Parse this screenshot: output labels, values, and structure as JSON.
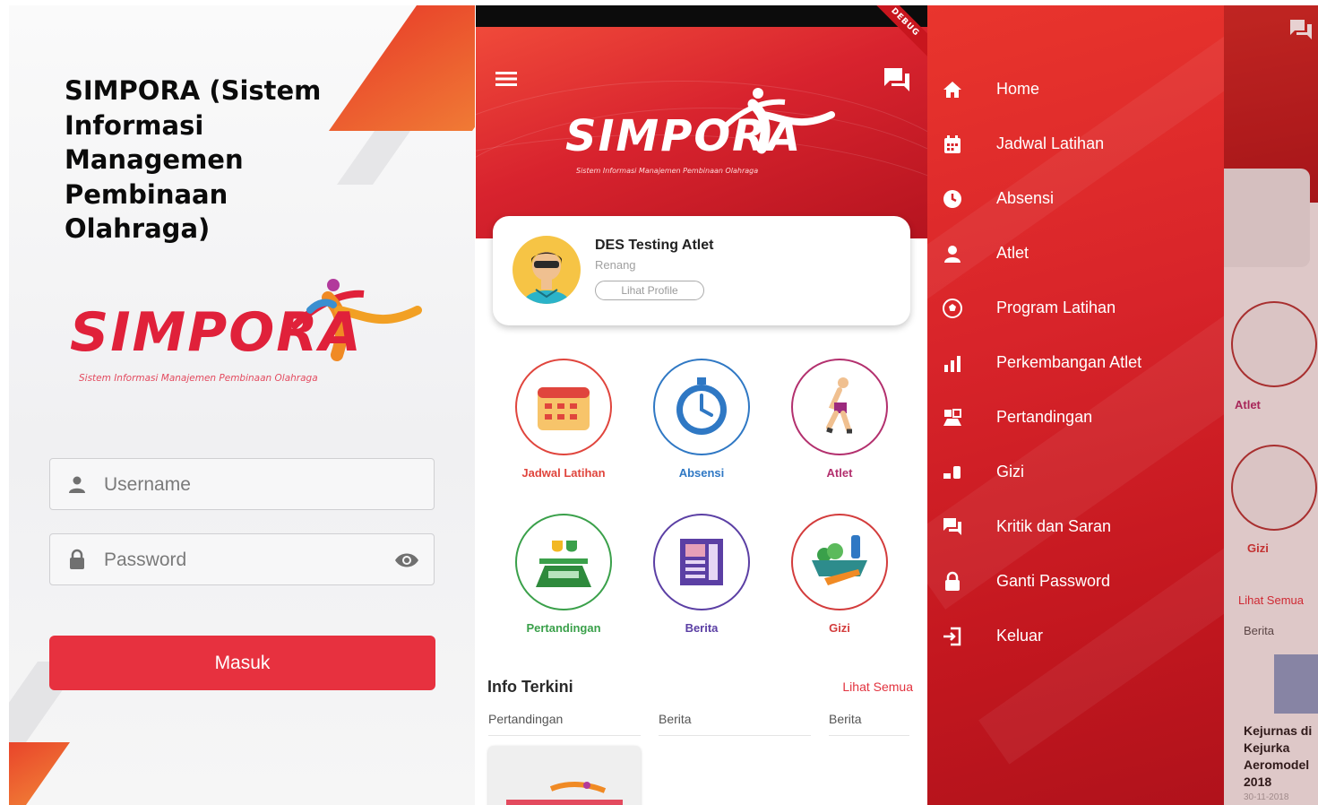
{
  "login": {
    "app_title": "SIMPORA (Sistem Informasi Managemen Pembinaan Olahraga)",
    "logo_word": "SIMPORA",
    "logo_tagline": "Sistem Informasi Manajemen Pembinaan Olahraga",
    "username_placeholder": "Username",
    "password_placeholder": "Password",
    "login_button": "Masuk"
  },
  "home": {
    "debug_banner": "DEBUG",
    "logo_word": "SIMPORA",
    "logo_tagline": "Sistem Informasi Manajemen Pembinaan Olahraga",
    "profile": {
      "name": "DES Testing Atlet",
      "sport": "Renang",
      "view_profile": "Lihat Profile"
    },
    "features": [
      {
        "label": "Jadwal Latihan",
        "color": "#e0453d",
        "icon": "calendar-icon"
      },
      {
        "label": "Absensi",
        "color": "#2f78c4",
        "icon": "stopwatch-icon"
      },
      {
        "label": "Atlet",
        "color": "#b3306e",
        "icon": "runner-icon"
      },
      {
        "label": "Pertandingan",
        "color": "#3aa04a",
        "icon": "competition-icon"
      },
      {
        "label": "Berita",
        "color": "#5b3fa4",
        "icon": "news-icon"
      },
      {
        "label": "Gizi",
        "color": "#d33c3c",
        "icon": "nutrition-icon"
      }
    ],
    "info": {
      "title": "Info Terkini",
      "see_all": "Lihat Semua",
      "categories": [
        "Pertandingan",
        "Berita",
        "Berita"
      ]
    }
  },
  "drawer": {
    "items": [
      {
        "label": "Home",
        "icon": "home-icon"
      },
      {
        "label": "Jadwal Latihan",
        "icon": "calendar-icon"
      },
      {
        "label": "Absensi",
        "icon": "clock-icon"
      },
      {
        "label": "Atlet",
        "icon": "person-icon"
      },
      {
        "label": "Program Latihan",
        "icon": "soccer-ball-icon"
      },
      {
        "label": "Perkembangan Atlet",
        "icon": "chart-icon"
      },
      {
        "label": "Pertandingan",
        "icon": "competition-icon"
      },
      {
        "label": "Gizi",
        "icon": "nutrition-icon"
      },
      {
        "label": "Kritik dan Saran",
        "icon": "chat-icon"
      },
      {
        "label": "Ganti Password",
        "icon": "lock-icon"
      },
      {
        "label": "Keluar",
        "icon": "logout-icon"
      }
    ],
    "behind": {
      "atlet": "Atlet",
      "gizi": "Gizi",
      "see_all": "Lihat Semua",
      "category": "Berita",
      "news_title": "Kejurnas di Kejurka Aeromodel 2018",
      "news_date": "30-11-2018"
    }
  },
  "colors": {
    "primary": "#e7313f",
    "header_red": "#d8232e",
    "drawer_red": "#c3171f"
  }
}
